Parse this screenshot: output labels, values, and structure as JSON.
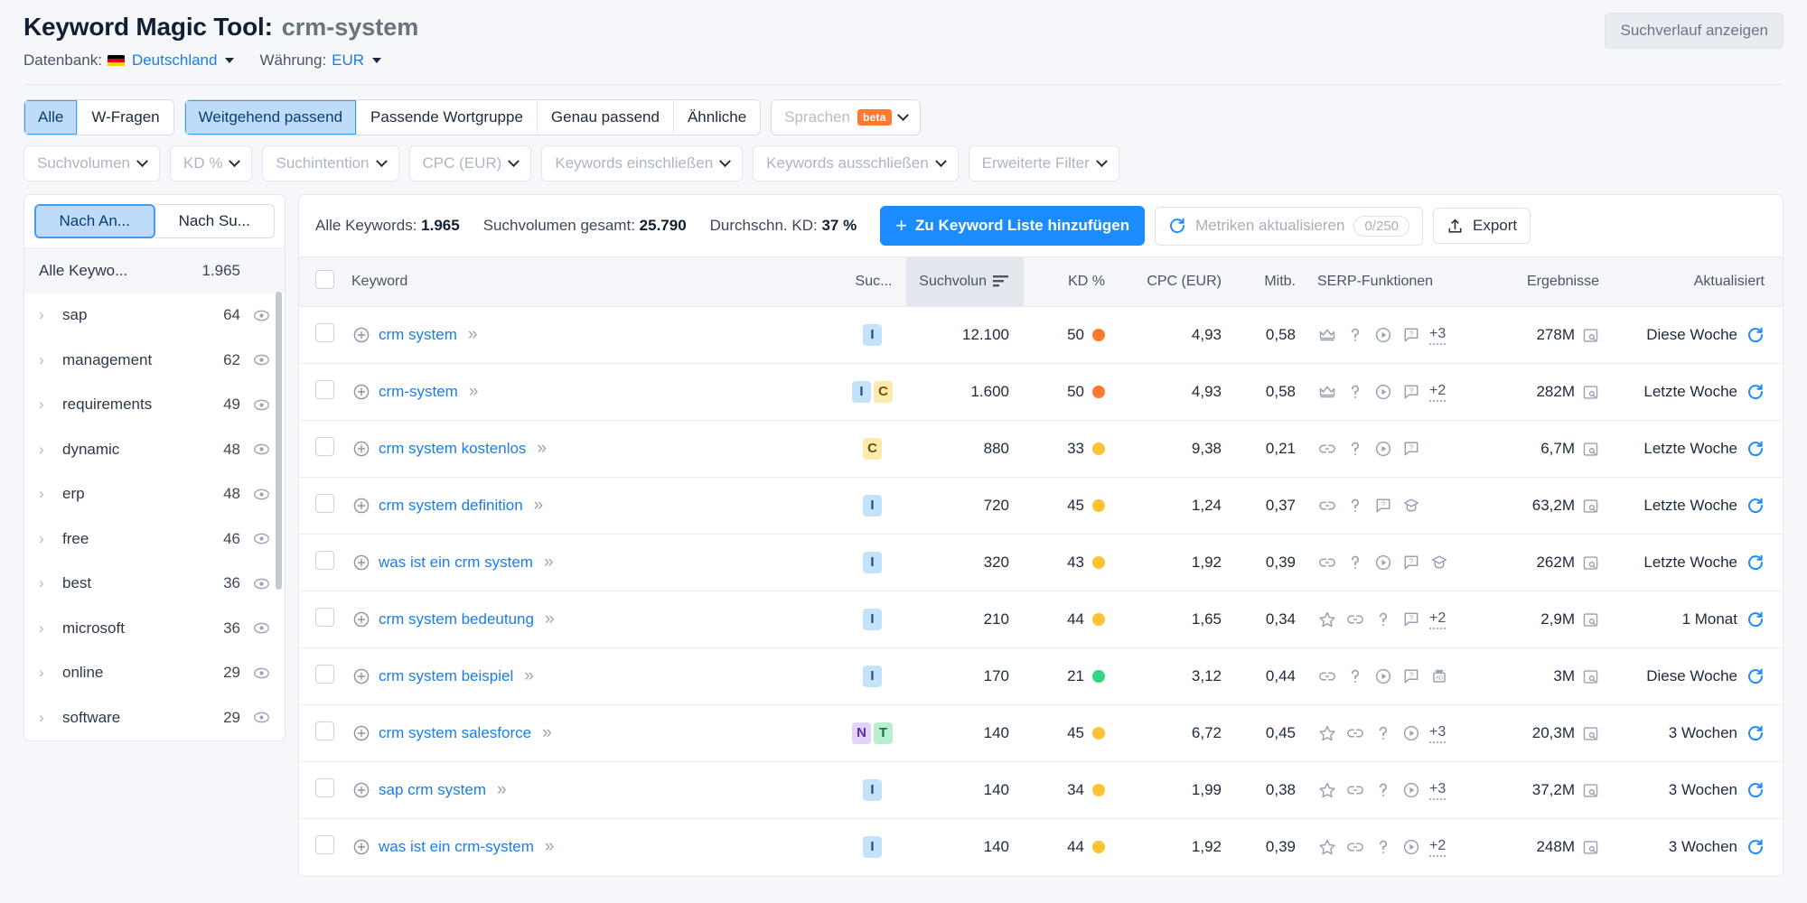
{
  "header": {
    "title_main": "Keyword Magic Tool:",
    "title_keyword": "crm-system",
    "history_button": "Suchverlauf anzeigen",
    "database_label": "Datenbank:",
    "database_value": "Deutschland",
    "currency_label": "Währung:",
    "currency_value": "EUR"
  },
  "filters": {
    "match_tabs": [
      {
        "label": "Alle",
        "active": true
      },
      {
        "label": "W-Fragen",
        "active": false
      }
    ],
    "match_types": [
      {
        "label": "Weitgehend passend",
        "active": true
      },
      {
        "label": "Passende Wortgruppe",
        "active": false
      },
      {
        "label": "Genau passend",
        "active": false
      },
      {
        "label": "Ähnliche",
        "active": false
      }
    ],
    "languages": {
      "label": "Sprachen",
      "badge": "beta"
    },
    "dropdowns": [
      "Suchvolumen",
      "KD %",
      "Suchintention",
      "CPC (EUR)",
      "Keywords einschließen",
      "Keywords ausschließen",
      "Erweiterte Filter"
    ]
  },
  "sidebar": {
    "tabs": [
      {
        "label": "Nach An...",
        "active": true
      },
      {
        "label": "Nach Su...",
        "active": false
      }
    ],
    "all_row": {
      "label": "Alle Keywo...",
      "count": "1.965"
    },
    "groups": [
      {
        "label": "sap",
        "count": "64"
      },
      {
        "label": "management",
        "count": "62"
      },
      {
        "label": "requirements",
        "count": "49"
      },
      {
        "label": "dynamic",
        "count": "48"
      },
      {
        "label": "erp",
        "count": "48"
      },
      {
        "label": "free",
        "count": "46"
      },
      {
        "label": "best",
        "count": "36"
      },
      {
        "label": "microsoft",
        "count": "36"
      },
      {
        "label": "online",
        "count": "29"
      },
      {
        "label": "software",
        "count": "29"
      }
    ]
  },
  "toolbar": {
    "stat_keywords_label": "Alle Keywords:",
    "stat_keywords_value": "1.965",
    "stat_volume_label": "Suchvolumen gesamt:",
    "stat_volume_value": "25.790",
    "stat_kd_label": "Durchschn. KD:",
    "stat_kd_value": "37 %",
    "add_button": "Zu Keyword Liste hinzufügen",
    "add_button_plus": "+",
    "refresh_button": "Metriken aktualisieren",
    "refresh_counter": "0/250",
    "export_button": "Export"
  },
  "table": {
    "columns": {
      "keyword": "Keyword",
      "intent": "Suc...",
      "volume": "Suchvolun",
      "kd": "KD %",
      "cpc": "CPC (EUR)",
      "competition": "Mitb.",
      "serp": "SERP-Funktionen",
      "results": "Ergebnisse",
      "updated": "Aktualisiert"
    },
    "sorted_by": "volume",
    "rows": [
      {
        "keyword": "crm system",
        "intent": [
          "I"
        ],
        "volume": "12.100",
        "kd": "50",
        "kd_color": "#ff7a2f",
        "cpc": "4,93",
        "competition": "0,58",
        "serp": [
          "crown",
          "question",
          "video",
          "comment"
        ],
        "serp_more": "+3",
        "results": "278M",
        "updated": "Diese Woche"
      },
      {
        "keyword": "crm-system",
        "intent": [
          "I",
          "C"
        ],
        "volume": "1.600",
        "kd": "50",
        "kd_color": "#ff7a2f",
        "cpc": "4,93",
        "competition": "0,58",
        "serp": [
          "crown",
          "question",
          "video",
          "comment"
        ],
        "serp_more": "+2",
        "results": "282M",
        "updated": "Letzte Woche"
      },
      {
        "keyword": "crm system kostenlos",
        "intent": [
          "C"
        ],
        "volume": "880",
        "kd": "33",
        "kd_color": "#ffc233",
        "cpc": "9,38",
        "competition": "0,21",
        "serp": [
          "link",
          "question",
          "video",
          "comment"
        ],
        "serp_more": "",
        "results": "6,7M",
        "updated": "Letzte Woche"
      },
      {
        "keyword": "crm system definition",
        "intent": [
          "I"
        ],
        "volume": "720",
        "kd": "45",
        "kd_color": "#ffc233",
        "cpc": "1,24",
        "competition": "0,37",
        "serp": [
          "link",
          "question",
          "comment",
          "graduate"
        ],
        "serp_more": "",
        "results": "63,2M",
        "updated": "Letzte Woche"
      },
      {
        "keyword": "was ist ein crm system",
        "intent": [
          "I"
        ],
        "volume": "320",
        "kd": "43",
        "kd_color": "#ffc233",
        "cpc": "1,92",
        "competition": "0,39",
        "serp": [
          "link",
          "question",
          "video",
          "comment",
          "graduate"
        ],
        "serp_more": "",
        "results": "262M",
        "updated": "Letzte Woche"
      },
      {
        "keyword": "crm system bedeutung",
        "intent": [
          "I"
        ],
        "volume": "210",
        "kd": "44",
        "kd_color": "#ffc233",
        "cpc": "1,65",
        "competition": "0,34",
        "serp": [
          "star",
          "link",
          "question",
          "comment"
        ],
        "serp_more": "+2",
        "results": "2,9M",
        "updated": "1 Monat"
      },
      {
        "keyword": "crm system beispiel",
        "intent": [
          "I"
        ],
        "volume": "170",
        "kd": "21",
        "kd_color": "#32d583",
        "cpc": "3,12",
        "competition": "0,44",
        "serp": [
          "link",
          "question",
          "video",
          "comment",
          "ads"
        ],
        "serp_more": "",
        "results": "3M",
        "updated": "Diese Woche"
      },
      {
        "keyword": "crm system salesforce",
        "intent": [
          "N",
          "T"
        ],
        "volume": "140",
        "kd": "45",
        "kd_color": "#ffc233",
        "cpc": "6,72",
        "competition": "0,45",
        "serp": [
          "star",
          "link",
          "question",
          "video"
        ],
        "serp_more": "+3",
        "results": "20,3M",
        "updated": "3 Wochen"
      },
      {
        "keyword": "sap crm system",
        "intent": [
          "I"
        ],
        "volume": "140",
        "kd": "34",
        "kd_color": "#ffc233",
        "cpc": "1,99",
        "competition": "0,38",
        "serp": [
          "star",
          "link",
          "question",
          "video"
        ],
        "serp_more": "+3",
        "results": "37,2M",
        "updated": "3 Wochen"
      },
      {
        "keyword": "was ist ein crm-system",
        "intent": [
          "I"
        ],
        "volume": "140",
        "kd": "44",
        "kd_color": "#ffc233",
        "cpc": "1,92",
        "competition": "0,39",
        "serp": [
          "star",
          "link",
          "question",
          "video"
        ],
        "serp_more": "+2",
        "results": "248M",
        "updated": "3 Wochen"
      }
    ]
  }
}
